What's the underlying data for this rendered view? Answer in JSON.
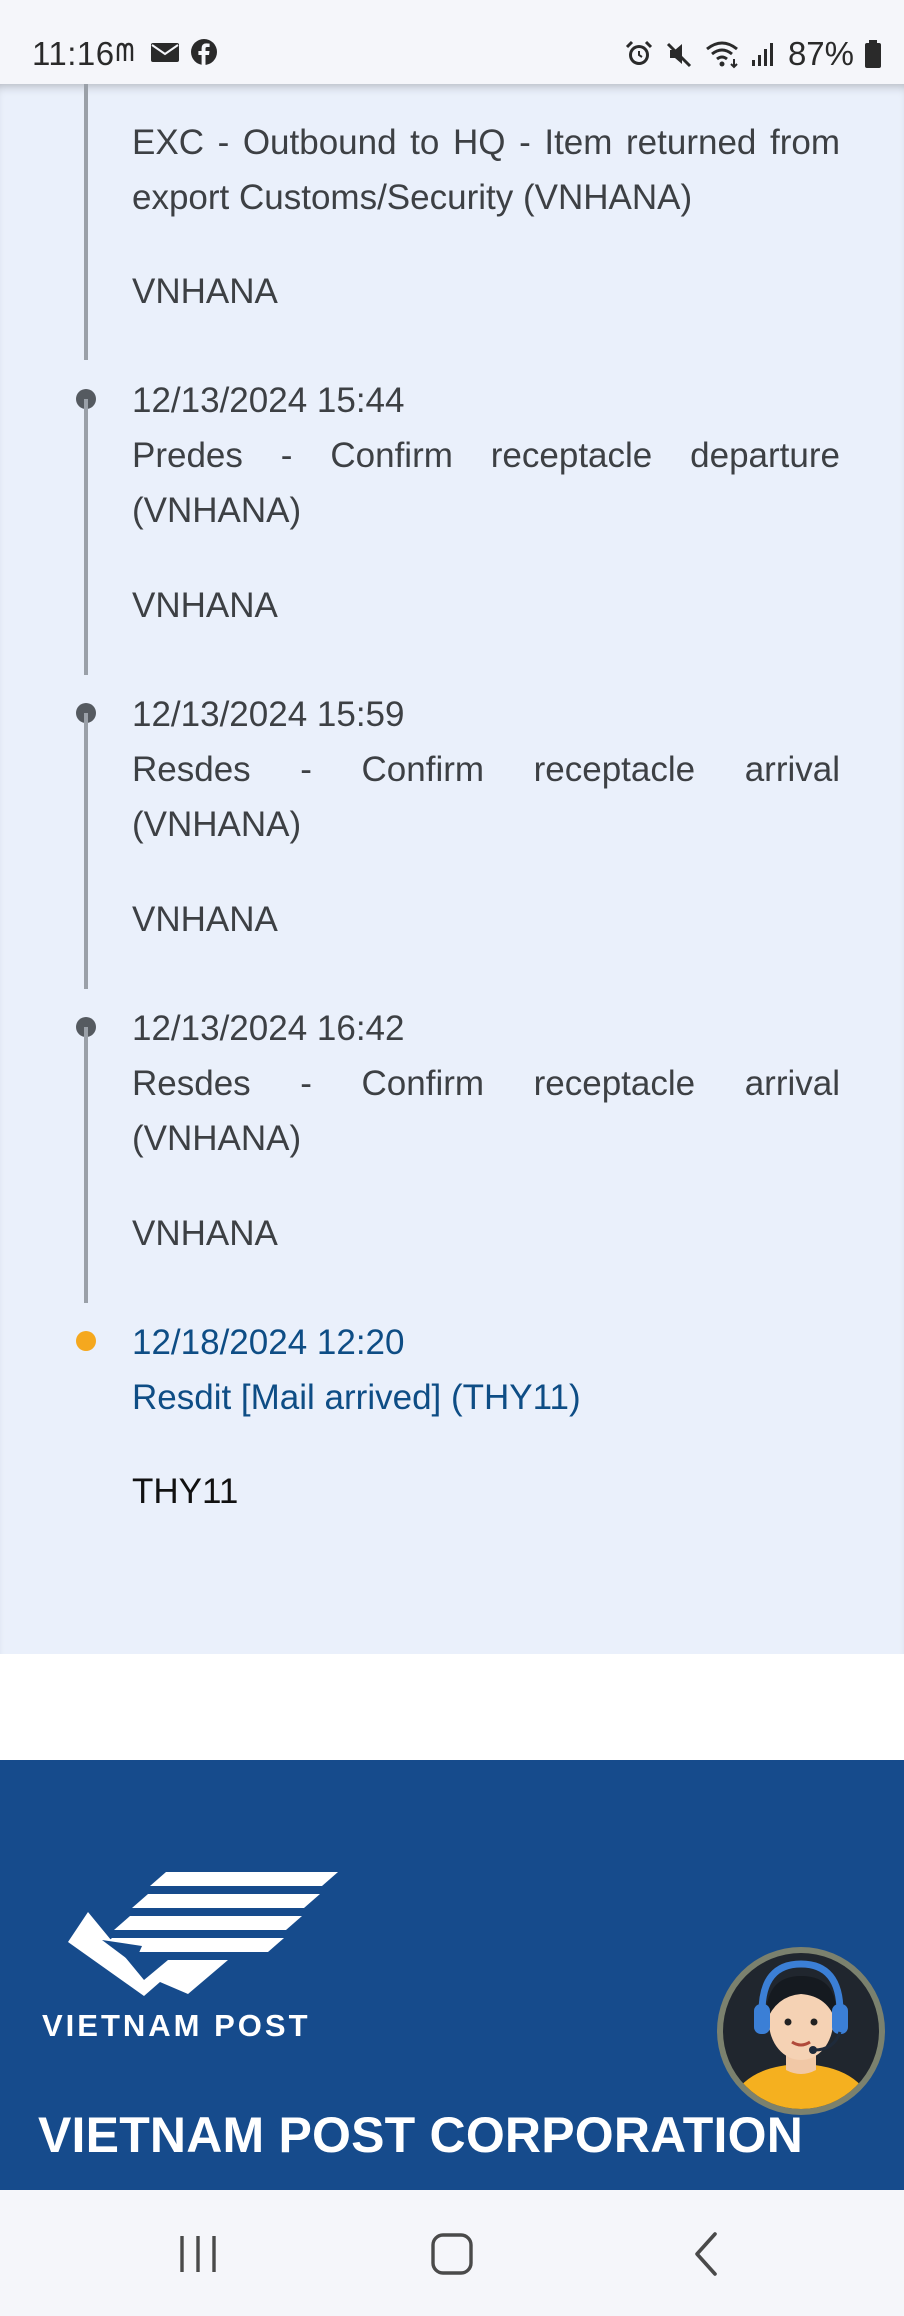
{
  "status_bar": {
    "time": "11:16",
    "left_icons": [
      "mcdonalds-icon",
      "mail-icon",
      "facebook-icon"
    ],
    "right_icons": [
      "alarm-icon",
      "mute-icon",
      "wifi-icon",
      "signal-icon"
    ],
    "battery_percent": "87%"
  },
  "timeline": {
    "events": [
      {
        "description": "EXC - Outbound to HQ - Item returned from export Customs/Security (VNHANA)",
        "location": "VNHANA"
      },
      {
        "datetime": "12/13/2024 15:44",
        "description": "Predes - Confirm receptacle departure (VNHANA)",
        "location": "VNHANA"
      },
      {
        "datetime": "12/13/2024 15:59",
        "description": "Resdes - Confirm receptacle arrival (VNHANA)",
        "location": "VNHANA"
      },
      {
        "datetime": "12/13/2024 16:42",
        "description": "Resdes - Confirm receptacle arrival (VNHANA)",
        "location": "VNHANA"
      },
      {
        "datetime": "12/18/2024 12:20",
        "description": "Resdit [Mail arrived] (THY11)",
        "location": "THY11"
      }
    ],
    "colors": {
      "past_dot": "#555a60",
      "latest_dot": "#f5a81e",
      "latest_text": "#0e4d85"
    }
  },
  "footer": {
    "logo_text": "VIETNAM POST",
    "corporation_name": "VIETNAM POST CORPORATION",
    "background": "#164b8c"
  },
  "nav_bar": {
    "buttons": [
      "recents-icon",
      "home-icon",
      "back-icon"
    ]
  }
}
